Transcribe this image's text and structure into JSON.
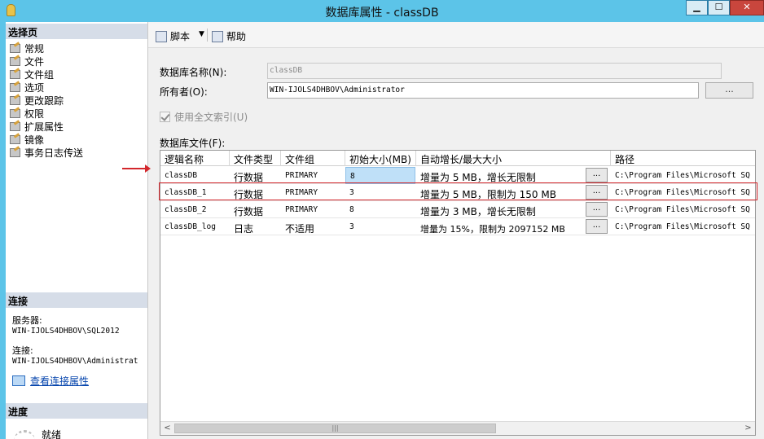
{
  "window": {
    "title": "数据库属性 - classDB",
    "min_glyph": "▁",
    "max_glyph": "☐",
    "close_glyph": "✕"
  },
  "left": {
    "pages_header": "选择页",
    "pages": [
      "常规",
      "文件",
      "文件组",
      "选项",
      "更改跟踪",
      "权限",
      "扩展属性",
      "镜像",
      "事务日志传送"
    ],
    "connection_header": "连接",
    "server_label": "服务器:",
    "server_value": "WIN-IJOLS4DHBOV\\SQL2012",
    "connection_label": "连接:",
    "connection_value": "WIN-IJOLS4DHBOV\\Administrat",
    "view_conn_link": "查看连接属性",
    "progress_header": "进度",
    "progress_status": "就绪"
  },
  "toolbar": {
    "script_label": "脚本",
    "dropdown_glyph": "▼",
    "help_label": "帮助"
  },
  "form": {
    "db_name_label": "数据库名称(N):",
    "db_name_value": "classDB",
    "owner_label": "所有者(O):",
    "owner_value": "WIN-IJOLS4DHBOV\\Administrator",
    "browse_label": "...",
    "fulltext_label": "使用全文索引(U)",
    "files_label": "数据库文件(F):"
  },
  "grid": {
    "headers": [
      "逻辑名称",
      "文件类型",
      "文件组",
      "初始大小(MB)",
      "自动增长/最大大小",
      "路径"
    ],
    "rows": [
      {
        "name": "classDB",
        "type": "行数据",
        "group": "PRIMARY",
        "size": "8",
        "growth": "增量为 5 MB，增长无限制",
        "path": "C:\\Program Files\\Microsoft SQ"
      },
      {
        "name": "classDB_1",
        "type": "行数据",
        "group": "PRIMARY",
        "size": "3",
        "growth": "增量为 5 MB，限制为 150 MB",
        "path": "C:\\Program Files\\Microsoft SQ"
      },
      {
        "name": "classDB_2",
        "type": "行数据",
        "group": "PRIMARY",
        "size": "8",
        "growth": "增量为 3 MB，增长无限制",
        "path": "C:\\Program Files\\Microsoft SQ"
      },
      {
        "name": "classDB_log",
        "type": "日志",
        "group": "不适用",
        "size": "3",
        "growth": "增量为 15%，限制为 2097152 MB",
        "path": "C:\\Program Files\\Microsoft SQ"
      }
    ],
    "ellipsis": "...",
    "scroll_left": "<",
    "scroll_right": ">",
    "scroll_grip": "|||"
  },
  "colors": {
    "titlebar": "#5cc4e8",
    "highlight": "#d3272c",
    "selected_cell": "#bfe0f8"
  }
}
